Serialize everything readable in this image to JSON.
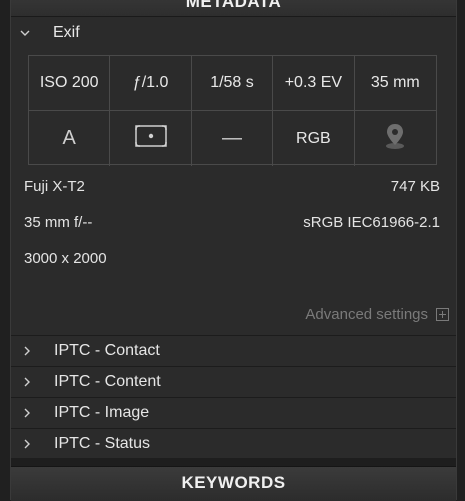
{
  "metadata_header": "METADATA",
  "exif": {
    "label": "Exif",
    "grid_top": [
      "ISO 200",
      "ƒ/1.0",
      "1/58 s",
      "+0.3 EV",
      "35 mm"
    ],
    "grid_bottom": {
      "mode": "A",
      "metering_icon": "spot-metering-icon",
      "flash": "—",
      "color_space": "RGB",
      "location_icon": "location-pin-icon"
    },
    "camera": "Fuji X-T2",
    "file_size": "747 KB",
    "lens": "35 mm f/--",
    "color_profile": "sRGB IEC61966-2.1",
    "dimensions": "3000 x 2000"
  },
  "advanced_settings": "Advanced settings",
  "sections": [
    {
      "label": "IPTC - Contact"
    },
    {
      "label": "IPTC - Content"
    },
    {
      "label": "IPTC - Image"
    },
    {
      "label": "IPTC - Status"
    }
  ],
  "keywords_header": "KEYWORDS",
  "colors": {
    "panel_bg": "#2b2b2b",
    "text": "#e6e6e6",
    "muted": "#7a7a7a",
    "border": "#4a4a4a"
  }
}
